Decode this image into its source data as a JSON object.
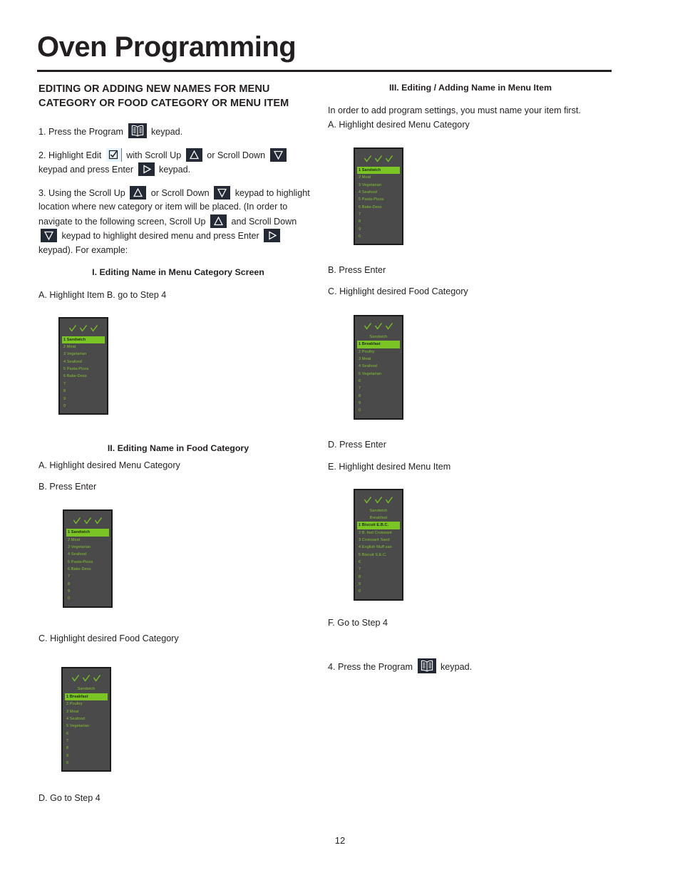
{
  "document": {
    "title": "Oven Programming",
    "page_number": "12"
  },
  "left": {
    "section_heading": "EDITING OR ADDING NEW NAMES FOR MENU CATEGORY OR FOOD CATEGORY OR MENU ITEM",
    "step1_a": "1. Press the Program",
    "step1_b": "keypad.",
    "step2_a": "2. Highlight Edit",
    "step2_b": "with Scroll Up",
    "step2_c": "or Scroll Down",
    "step2_d": "keypad and press Enter",
    "step2_e": "keypad.",
    "step3_a": "3. Using the Scroll Up",
    "step3_b": "or Scroll Down",
    "step3_c": "keypad to highlight location where new category or item will be placed. (In order to navigate to the following screen, Scroll Up",
    "step3_d": "and Scroll Down",
    "step3_e": "keypad to highlight desired menu and press Enter",
    "step3_f": "keypad). For example:",
    "sub1": "I. Editing Name in Menu Category Screen",
    "sub1_line": "A. Highlight Item      B. go to Step 4",
    "sub2": "II. Editing Name in Food Category",
    "sub2_a": "A. Highlight desired Menu Category",
    "sub2_b": "B. Press Enter",
    "sub2_c": "C. Highlight desired Food Category",
    "sub2_d": "D. Go to Step 4"
  },
  "right": {
    "sub3": "III. Editing / Adding Name in Menu Item",
    "intro": "In order to add program settings, you must name your item first.",
    "step_a": " A. Highlight desired Menu Category",
    "step_b": "B. Press Enter",
    "step_c": "C. Highlight desired Food Category",
    "step_d": "D. Press Enter",
    "step_e": "E. Highlight desired Menu Item",
    "step_f": "F. Go to Step 4",
    "step4_a": "4. Press the Program",
    "step4_b": "keypad."
  },
  "icons": {
    "program": "program-book-icon",
    "edit": "edit-checkbox-icon",
    "scroll_up": "scroll-up-triangle-icon",
    "scroll_down": "scroll-down-triangle-icon",
    "enter": "enter-triangle-icon"
  },
  "colors": {
    "lcd_background": "#4a4a4a",
    "lcd_text": "#86c232",
    "lcd_highlight": "#7ac524",
    "lcd_highlight_text": "#1c2b0c",
    "keypad_background": "#232a35",
    "edit_background": "#e8f4fb",
    "ink": "#231f20"
  },
  "screens": {
    "menu_category_1": {
      "checks": 3,
      "headers": [],
      "rows": [
        {
          "text": "1 Sandwich",
          "selected": true
        },
        {
          "text": "2 Meat",
          "selected": false
        },
        {
          "text": "3 Vegetarian",
          "selected": false
        },
        {
          "text": "4 Seafood",
          "selected": false
        },
        {
          "text": "5 Pasta-Pizza",
          "selected": false
        },
        {
          "text": "6 Bake-Dess",
          "selected": false
        },
        {
          "text": "7",
          "selected": false
        },
        {
          "text": "8",
          "selected": false
        },
        {
          "text": "9",
          "selected": false
        },
        {
          "text": "0",
          "selected": false
        }
      ]
    },
    "menu_category_2": {
      "checks": 3,
      "headers": [],
      "rows": [
        {
          "text": "1 Sandwich",
          "selected": true
        },
        {
          "text": "2 Meat",
          "selected": false
        },
        {
          "text": "3 Vegetarian",
          "selected": false
        },
        {
          "text": "4 Seafood",
          "selected": false
        },
        {
          "text": "5 Pasta-Pizza",
          "selected": false
        },
        {
          "text": "6 Bake-Dess",
          "selected": false
        },
        {
          "text": "7",
          "selected": false
        },
        {
          "text": "8",
          "selected": false
        },
        {
          "text": "9",
          "selected": false
        },
        {
          "text": "0",
          "selected": false
        }
      ]
    },
    "food_category_1": {
      "checks": 3,
      "headers": [
        "Sandwich"
      ],
      "rows": [
        {
          "text": "1 Breakfast",
          "selected": true
        },
        {
          "text": "2 Poultry",
          "selected": false
        },
        {
          "text": "3 Meat",
          "selected": false
        },
        {
          "text": "4 Seafood",
          "selected": false
        },
        {
          "text": "5 Vegetarian",
          "selected": false
        },
        {
          "text": "6",
          "selected": false
        },
        {
          "text": "7",
          "selected": false
        },
        {
          "text": "8",
          "selected": false
        },
        {
          "text": "9",
          "selected": false
        },
        {
          "text": "0",
          "selected": false
        }
      ]
    },
    "menu_category_3": {
      "checks": 3,
      "headers": [],
      "rows": [
        {
          "text": "1 Sandwich",
          "selected": true
        },
        {
          "text": "2 Meat",
          "selected": false
        },
        {
          "text": "3 Vegetarian",
          "selected": false
        },
        {
          "text": "4 Seafood",
          "selected": false
        },
        {
          "text": "5 Pasta-Pizza",
          "selected": false
        },
        {
          "text": "6 Bake-Dess",
          "selected": false
        },
        {
          "text": "7",
          "selected": false
        },
        {
          "text": "8",
          "selected": false
        },
        {
          "text": "9",
          "selected": false
        },
        {
          "text": "0",
          "selected": false
        }
      ]
    },
    "food_category_2": {
      "checks": 3,
      "headers": [
        "Sandwich"
      ],
      "rows": [
        {
          "text": "1 Breakfast",
          "selected": true
        },
        {
          "text": "2 Poultry",
          "selected": false
        },
        {
          "text": "3 Meat",
          "selected": false
        },
        {
          "text": "4 Seafood",
          "selected": false
        },
        {
          "text": "5 Vegetarian",
          "selected": false
        },
        {
          "text": "6",
          "selected": false
        },
        {
          "text": "7",
          "selected": false
        },
        {
          "text": "8",
          "selected": false
        },
        {
          "text": "9",
          "selected": false
        },
        {
          "text": "0",
          "selected": false
        }
      ]
    },
    "menu_item": {
      "checks": 3,
      "headers": [
        "Sandwich",
        "Breakfast"
      ],
      "rows": [
        {
          "text": "1 Biscuit E.B.C.",
          "selected": true
        },
        {
          "text": "2 B. fast Croissant",
          "selected": false
        },
        {
          "text": "3 Croissant Sand",
          "selected": false
        },
        {
          "text": "4 English Muff san",
          "selected": false
        },
        {
          "text": "5 Biscuit S.E.C.",
          "selected": false
        },
        {
          "text": "6",
          "selected": false
        },
        {
          "text": "7",
          "selected": false
        },
        {
          "text": "8",
          "selected": false
        },
        {
          "text": "9",
          "selected": false
        },
        {
          "text": "0",
          "selected": false
        }
      ]
    }
  }
}
